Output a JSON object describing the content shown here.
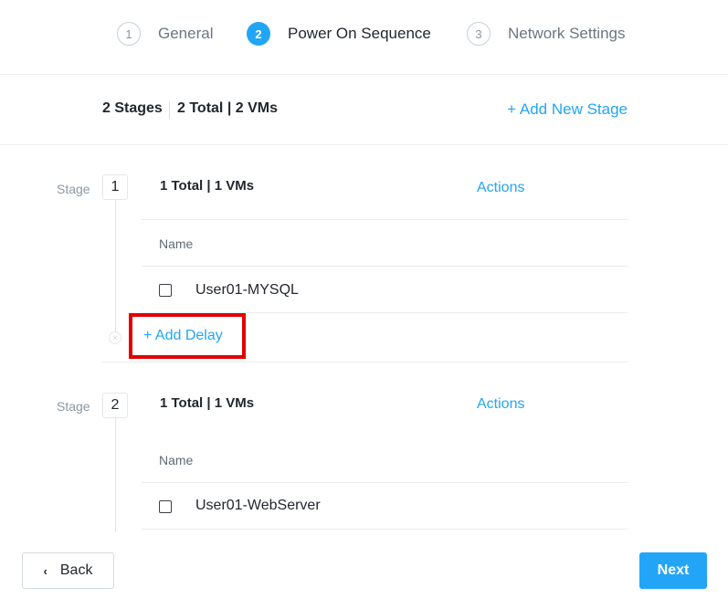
{
  "stepper": {
    "steps": [
      {
        "number": "1",
        "label": "General",
        "state": "inactive"
      },
      {
        "number": "2",
        "label": "Power On Sequence",
        "state": "active"
      },
      {
        "number": "3",
        "label": "Network Settings",
        "state": "inactive"
      }
    ]
  },
  "summary": {
    "stages": "2 Stages",
    "totals": "2 Total | 2 VMs",
    "add_stage": "+ Add New Stage"
  },
  "stages": [
    {
      "label": "Stage",
      "number": "1",
      "totals": "1 Total | 1 VMs",
      "actions": "Actions",
      "column_name": "Name",
      "vms": [
        {
          "name": "User01-MYSQL",
          "checked": false
        }
      ],
      "add_delay": "+ Add Delay"
    },
    {
      "label": "Stage",
      "number": "2",
      "totals": "1 Total | 1 VMs",
      "actions": "Actions",
      "column_name": "Name",
      "vms": [
        {
          "name": "User01-WebServer",
          "checked": false
        }
      ]
    }
  ],
  "footer": {
    "back": "Back",
    "next": "Next"
  },
  "colors": {
    "accent": "#22a5f7",
    "highlight": "#e00000"
  }
}
